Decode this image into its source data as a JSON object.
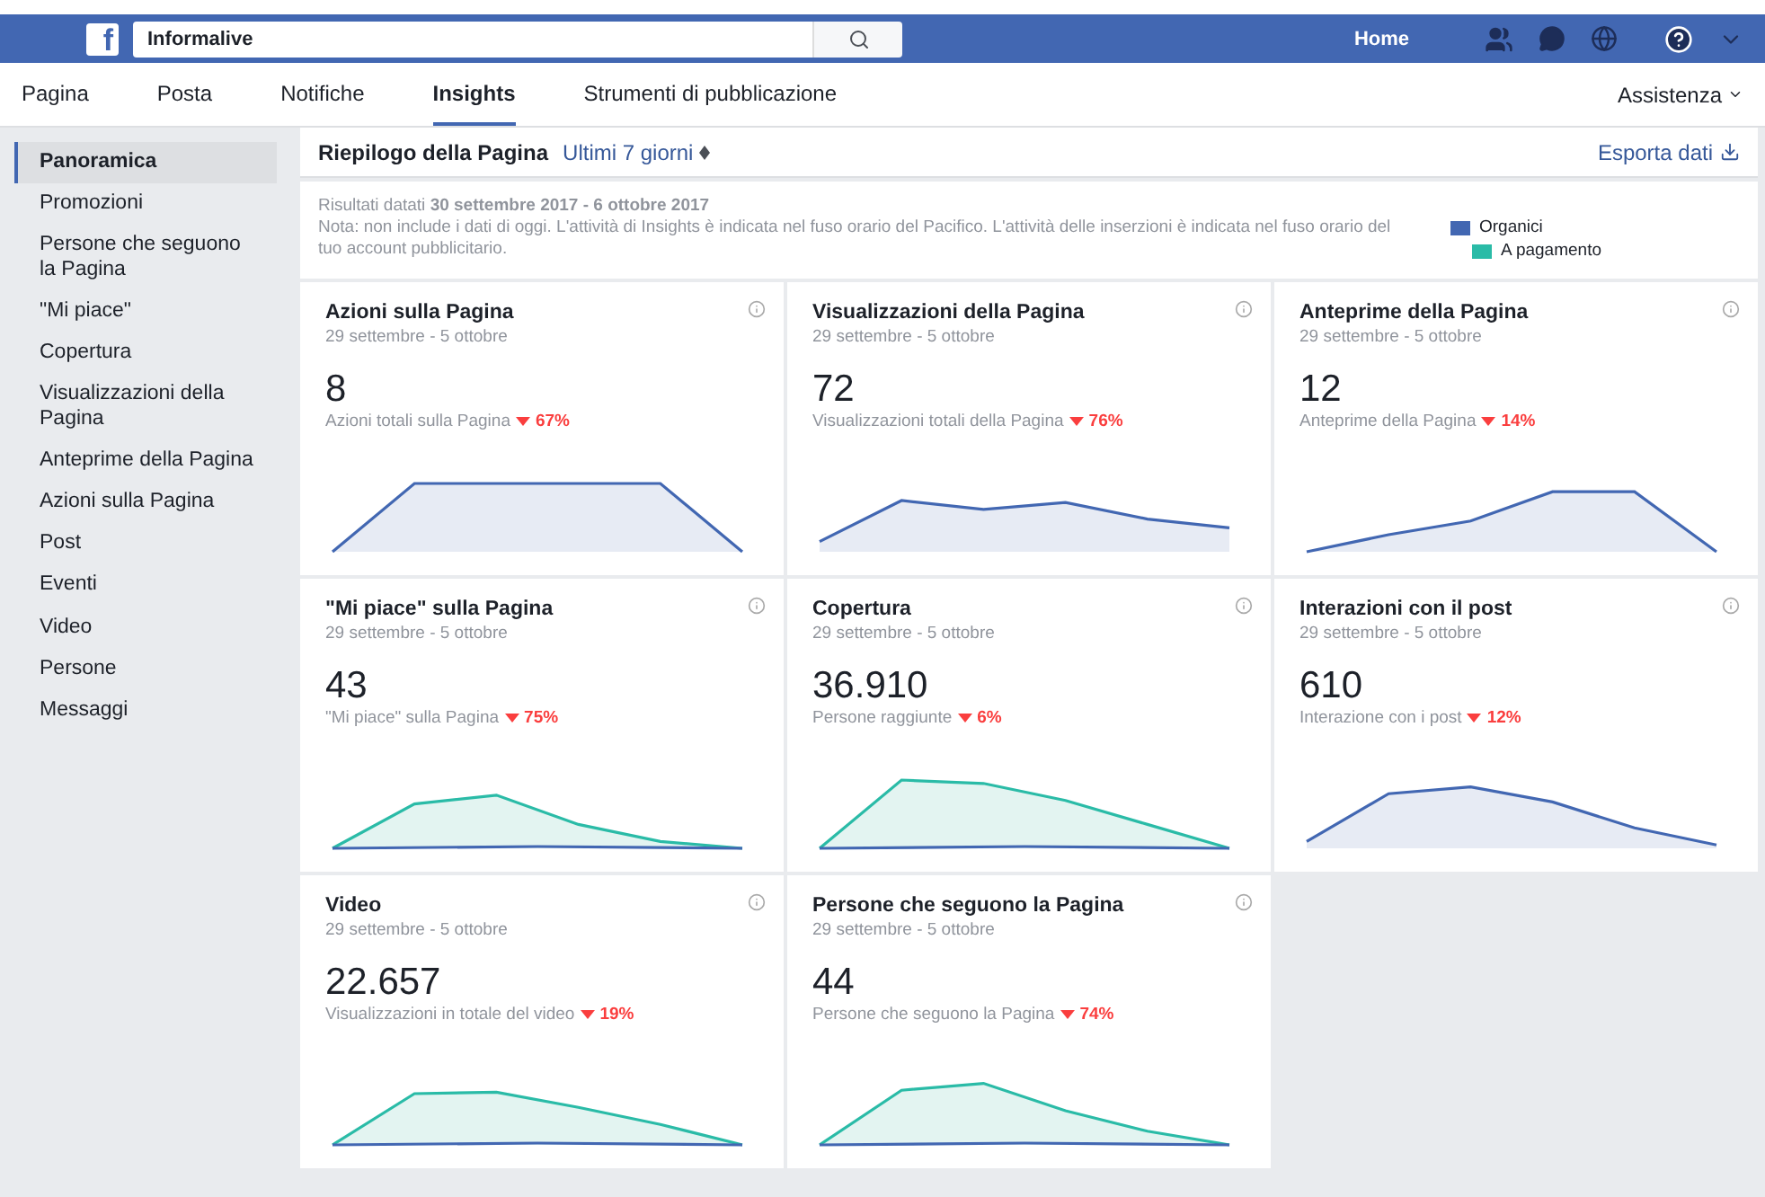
{
  "topbar": {
    "logo_letter": "f",
    "search": {
      "value": "Informalive"
    },
    "home": "Home"
  },
  "nav": {
    "tabs": [
      {
        "label": "Pagina",
        "selected": false
      },
      {
        "label": "Posta",
        "selected": false
      },
      {
        "label": "Notifiche",
        "selected": false
      },
      {
        "label": "Insights",
        "selected": true
      },
      {
        "label": "Strumenti di pubblicazione",
        "selected": false
      }
    ],
    "help": "Assistenza"
  },
  "sidebar": {
    "items": [
      {
        "label": "Panoramica",
        "selected": true
      },
      {
        "label": "Promozioni",
        "selected": false
      },
      {
        "label": "Persone che seguono la Pagina",
        "selected": false
      },
      {
        "label": "\"Mi piace\"",
        "selected": false
      },
      {
        "label": "Copertura",
        "selected": false
      },
      {
        "label": "Visualizzazioni della Pagina",
        "selected": false
      },
      {
        "label": "Anteprime della Pagina",
        "selected": false
      },
      {
        "label": "Azioni sulla Pagina",
        "selected": false
      },
      {
        "label": "Post",
        "selected": false
      },
      {
        "label": "Eventi",
        "selected": false
      },
      {
        "label": "Video",
        "selected": false
      },
      {
        "label": "Persone",
        "selected": false
      },
      {
        "label": "Messaggi",
        "selected": false
      }
    ]
  },
  "summary": {
    "title": "Riepilogo della Pagina",
    "period": "Ultimi 7 giorni",
    "export": "Esporta dati",
    "dates": "Risultati datati **30 settembre 2017 - 6 ottobre 2017**",
    "note": "Nota: non include i dati di oggi. L'attività di Insights è indicata nel fuso orario del Pacifico. L'attività delle inserzioni è indicata nel fuso orario del tuo account pubblicitario.",
    "legend": [
      {
        "label": "Organici",
        "color": "#4267b2"
      },
      {
        "label": "A pagamento",
        "color": "#2abba7"
      }
    ]
  },
  "cards": [
    {
      "title": "Azioni sulla Pagina",
      "dates": "29 settembre - 5 ottobre",
      "value": "8",
      "caption": "Azioni totali sulla Pagina",
      "change": "67%",
      "kind": "organic"
    },
    {
      "title": "Visualizzazioni della Pagina",
      "dates": "29 settembre - 5 ottobre",
      "value": "72",
      "caption": "Visualizzazioni totali della Pagina",
      "change": "76%",
      "kind": "organic"
    },
    {
      "title": "Anteprime della Pagina",
      "dates": "29 settembre - 5 ottobre",
      "value": "12",
      "caption": "Anteprime della Pagina",
      "change": "14%",
      "kind": "organic"
    },
    {
      "title": "\"Mi piace\" sulla Pagina",
      "dates": "29 settembre - 5 ottobre",
      "value": "43",
      "caption": "\"Mi piace\" sulla Pagina",
      "change": "75%",
      "kind": "paid"
    },
    {
      "title": "Copertura",
      "dates": "29 settembre - 5 ottobre",
      "value": "36.910",
      "caption": "Persone raggiunte",
      "change": "6%",
      "kind": "paid"
    },
    {
      "title": "Interazioni con il post",
      "dates": "29 settembre - 5 ottobre",
      "value": "610",
      "caption": "Interazione con i post",
      "change": "12%",
      "kind": "organic"
    },
    {
      "title": "Video",
      "dates": "29 settembre - 5 ottobre",
      "value": "22.657",
      "caption": "Visualizzazioni in totale del video",
      "change": "19%",
      "kind": "paid"
    },
    {
      "title": "Persone che seguono la Pagina",
      "dates": "29 settembre - 5 ottobre",
      "value": "44",
      "caption": "Persone che seguono la Pagina",
      "change": "74%",
      "kind": "paid"
    }
  ]
}
